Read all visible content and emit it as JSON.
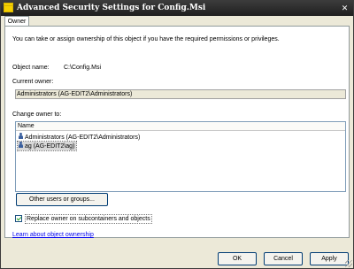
{
  "window": {
    "title": "Advanced Security Settings for Config.Msi",
    "close_glyph": "✕"
  },
  "tabs": [
    {
      "label": "Owner",
      "selected": true
    }
  ],
  "owner_panel": {
    "intro": "You can take or assign ownership of this object if you have the required permissions or privileges.",
    "object_name_label": "Object name:",
    "object_name_value": "C:\\Config.Msi",
    "current_owner_label": "Current owner:",
    "current_owner_value": "Administrators (AG-EDIT2\\Administrators)",
    "change_owner_label": "Change owner to:",
    "list": {
      "column_header": "Name",
      "rows": [
        {
          "name": "Administrators (AG-EDIT2\\Administrators)",
          "icon": "group-icon",
          "selected": false
        },
        {
          "name": "ag (AG-EDIT2\\ag)",
          "icon": "user-icon",
          "selected": true
        }
      ]
    },
    "other_users_button": "Other users or groups...",
    "replace_checkbox": {
      "label": "Replace owner on subcontainers and objects",
      "checked": true
    },
    "learn_link": "Learn about object ownership"
  },
  "footer": {
    "ok": "OK",
    "cancel": "Cancel",
    "apply": "Apply"
  },
  "colors": {
    "titlebar": "#2a2a2a",
    "dialog_bg": "#ece9d8",
    "link": "#0000ee",
    "button_border": "#003c74"
  }
}
